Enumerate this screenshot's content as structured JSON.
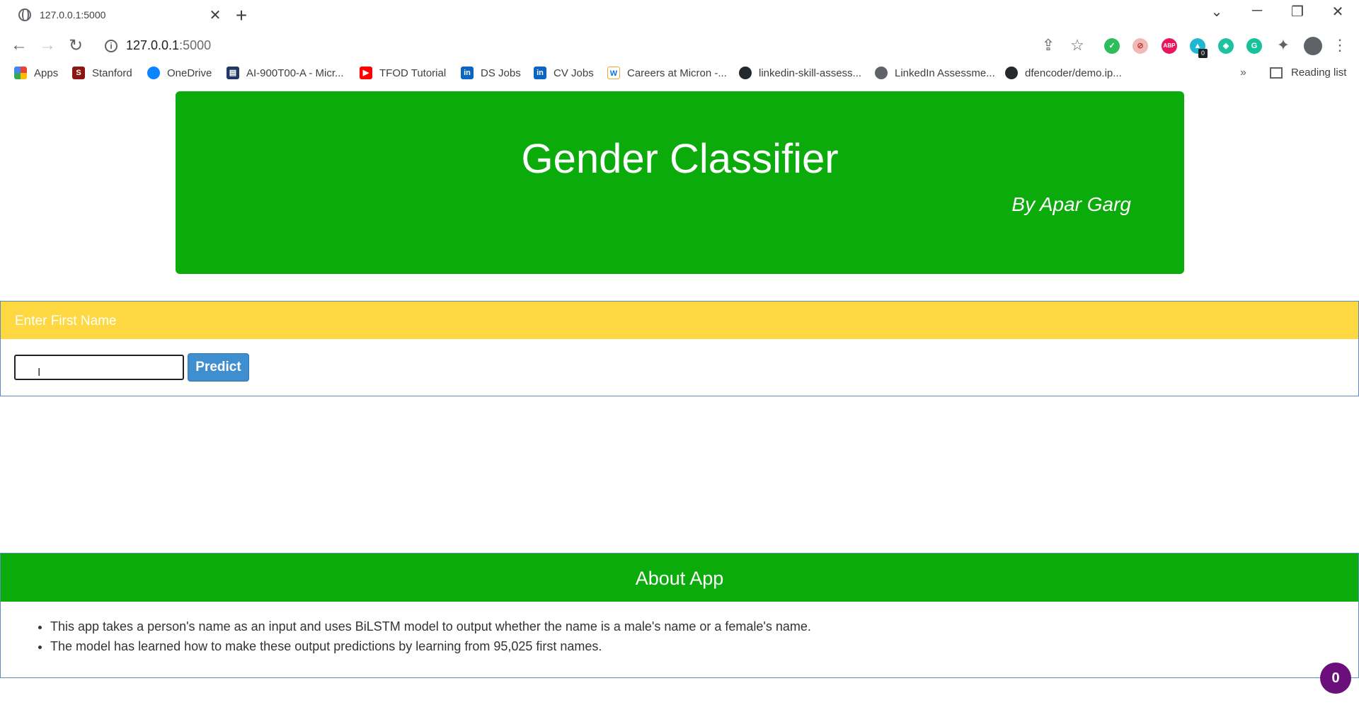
{
  "browser": {
    "tab_title": "127.0.0.1:5000",
    "tab_close": "✕",
    "new_tab": "+",
    "url_host": "127.0.0.1",
    "url_port": ":5000",
    "window_controls": [
      "⌄",
      "─",
      "❐",
      "✕"
    ],
    "bookmarks": [
      {
        "label": "Apps",
        "icon": "apps-grid-icon",
        "color": "#ea4335"
      },
      {
        "label": "Stanford",
        "icon": "stanford-icon",
        "color": "#8c1515"
      },
      {
        "label": "OneDrive",
        "icon": "cloud-icon",
        "color": "#0a84ff"
      },
      {
        "label": "AI-900T00-A - Micr...",
        "icon": "document-icon",
        "color": "#1f3864"
      },
      {
        "label": "TFOD Tutorial",
        "icon": "youtube-icon",
        "color": "#ff0000"
      },
      {
        "label": "DS Jobs",
        "icon": "linkedin-icon",
        "color": "#0a66c2"
      },
      {
        "label": "CV Jobs",
        "icon": "linkedin-icon",
        "color": "#0a66c2"
      },
      {
        "label": "Careers at Micron -...",
        "icon": "workday-icon",
        "color": "#f5a623"
      },
      {
        "label": "linkedin-skill-assess...",
        "icon": "github-icon",
        "color": "#24292e"
      },
      {
        "label": "LinkedIn Assessme...",
        "icon": "globe-icon",
        "color": "#5f6368"
      },
      {
        "label": "dfencoder/demo.ip...",
        "icon": "github-icon",
        "color": "#24292e"
      }
    ],
    "bookmarks_overflow": "»",
    "reading_list": "Reading list",
    "extension_badge_count": "0"
  },
  "header": {
    "title": "Gender Classifier",
    "byline": "By Apar Garg",
    "color": "#0aab0a"
  },
  "name_panel": {
    "heading": "Enter First Name",
    "input_value": "",
    "button_label": "Predict",
    "heading_color": "#fdd840"
  },
  "about_panel": {
    "heading": "About App",
    "items": [
      "This app takes a person's name as an input and uses BiLSTM model to output whether the name is a male's name or a female's name.",
      "The model has learned how to make these output predictions by learning from 95,025 first names."
    ]
  },
  "floating_badge": "0"
}
